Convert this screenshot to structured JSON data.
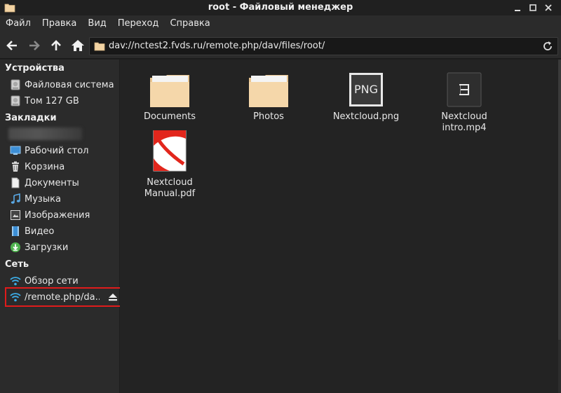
{
  "window": {
    "title": "root - Файловый менеджер"
  },
  "menu": [
    "Файл",
    "Правка",
    "Вид",
    "Переход",
    "Справка"
  ],
  "location": {
    "path": "dav://nctest2.fvds.ru/remote.php/dav/files/root/"
  },
  "sidebar": {
    "devices_header": "Устройства",
    "devices": [
      {
        "label": "Файловая система",
        "icon": "drive-icon"
      },
      {
        "label": "Том 127 GB",
        "icon": "drive-icon"
      }
    ],
    "bookmarks_header": "Закладки",
    "bookmarks": [
      {
        "label": "Рабочий стол",
        "icon": "desktop-icon"
      },
      {
        "label": "Корзина",
        "icon": "trash-icon"
      },
      {
        "label": "Документы",
        "icon": "document-icon"
      },
      {
        "label": "Музыка",
        "icon": "music-icon"
      },
      {
        "label": "Изображения",
        "icon": "image-icon"
      },
      {
        "label": "Видео",
        "icon": "video-icon"
      },
      {
        "label": "Загрузки",
        "icon": "download-icon"
      }
    ],
    "network_header": "Сеть",
    "network": [
      {
        "label": "Обзор сети",
        "icon": "wifi-icon"
      },
      {
        "label": "/remote.php/da...",
        "icon": "wifi-icon"
      }
    ]
  },
  "files": [
    {
      "name": "Documents",
      "type": "folder"
    },
    {
      "name": "Photos",
      "type": "folder"
    },
    {
      "name": "Nextcloud.png",
      "type": "png",
      "badge": "PNG"
    },
    {
      "name": "Nextcloud intro.mp4",
      "type": "video"
    },
    {
      "name_line1": "Nextcloud",
      "name_line2": "Manual.pdf",
      "type": "pdf"
    }
  ],
  "colors": {
    "highlight": "#e01b1b",
    "accent": "#3daee9",
    "folder": "#f2d3a3"
  }
}
